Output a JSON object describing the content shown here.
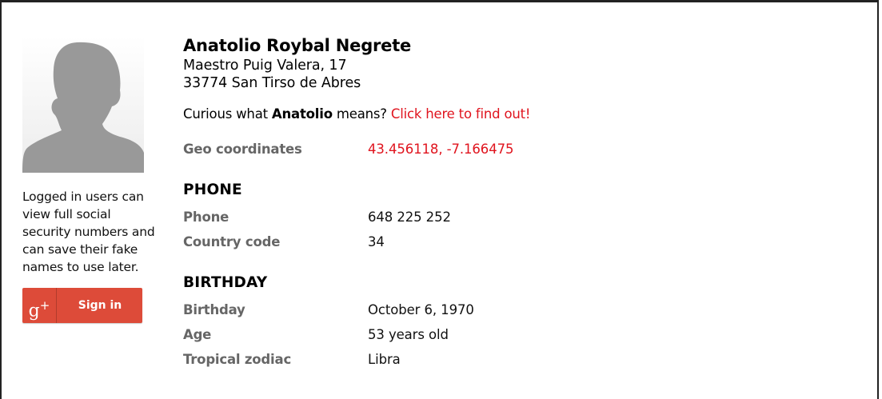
{
  "person": {
    "name": "Anatolio Roybal Negrete",
    "address_line1": "Maestro Puig Valera, 17",
    "address_line2": "33774 San Tirso de Abres",
    "curious_prefix": "Curious what ",
    "first_name": "Anatolio",
    "curious_suffix": " means? ",
    "curious_link": "Click here to find out!"
  },
  "geo": {
    "label": "Geo coordinates",
    "value": "43.456118, -7.166475"
  },
  "phone_section": {
    "title": "PHONE",
    "rows": [
      {
        "label": "Phone",
        "value": "648 225 252"
      },
      {
        "label": "Country code",
        "value": "34"
      }
    ]
  },
  "birthday_section": {
    "title": "BIRTHDAY",
    "rows": [
      {
        "label": "Birthday",
        "value": "October 6, 1970"
      },
      {
        "label": "Age",
        "value": "53 years old"
      },
      {
        "label": "Tropical zodiac",
        "value": "Libra"
      }
    ]
  },
  "sidebar": {
    "login_note": "Logged in users can view full social security numbers and can save their fake names to use later.",
    "signin_icon": "google-plus-icon",
    "signin_icon_text": "g",
    "signin_icon_plus": "+",
    "signin_label": "Sign in"
  },
  "colors": {
    "accent_red": "#e0141e",
    "google_red": "#dd4b39",
    "label_gray": "#666666"
  }
}
